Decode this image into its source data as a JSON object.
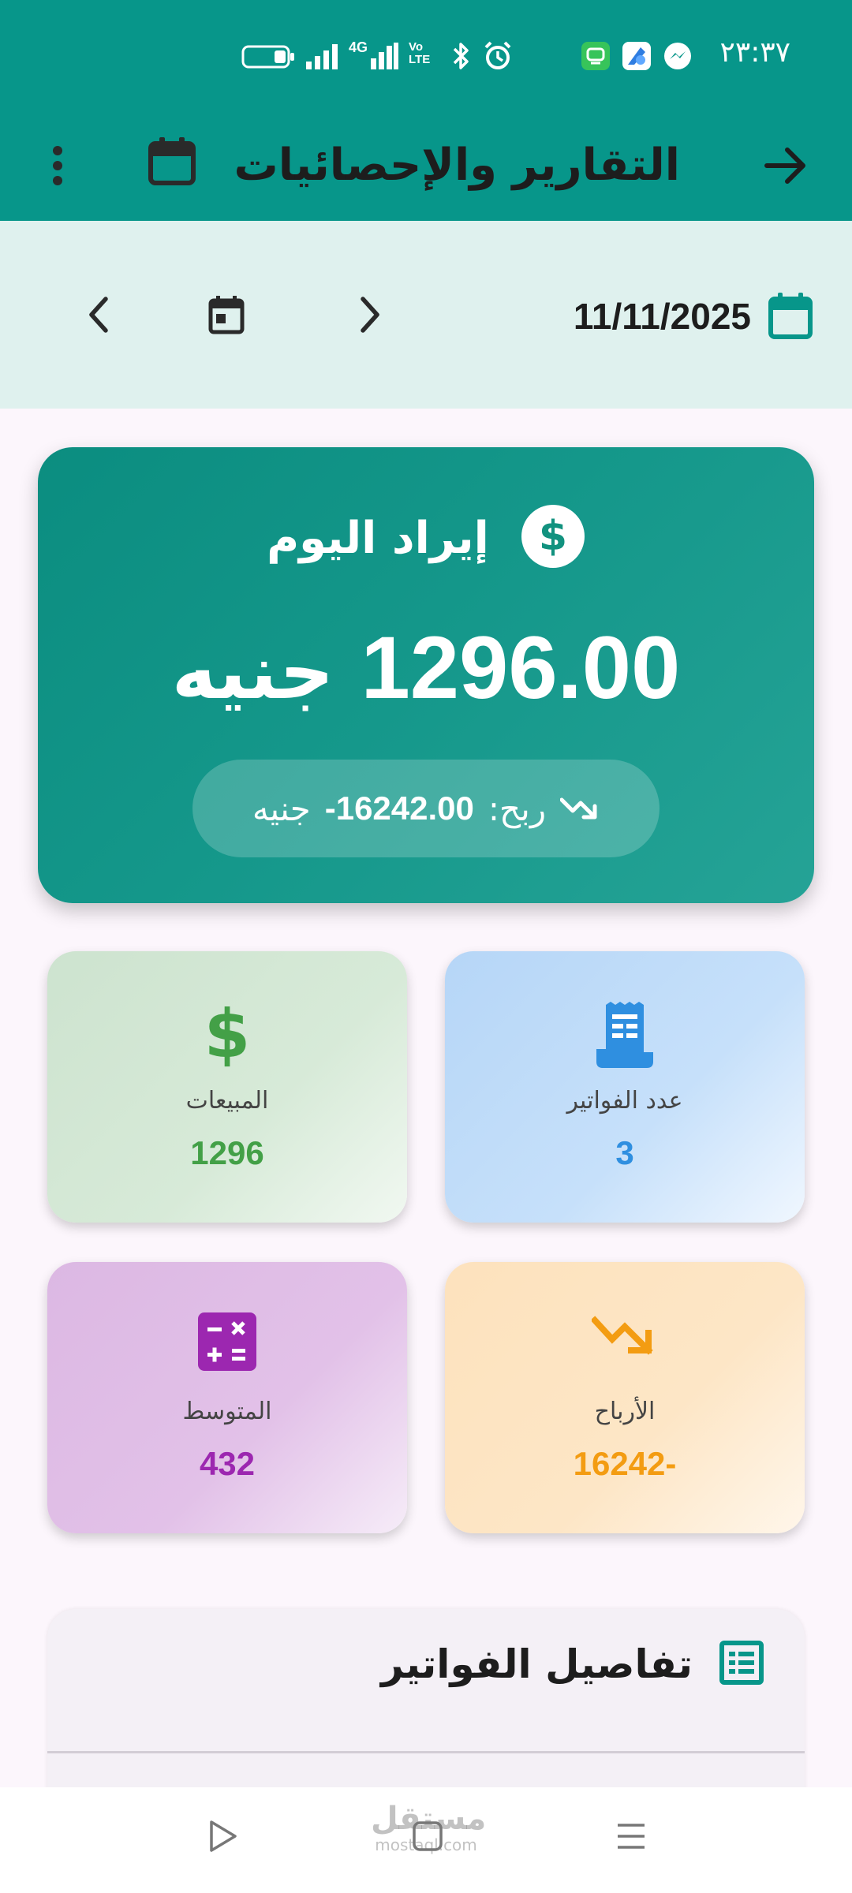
{
  "status_bar": {
    "time": "٢٣:٣٧",
    "battery_icon": "battery-icon",
    "signal_icon": "signal-icon",
    "network_label": "4G",
    "volte_label": "Vo LTE",
    "bluetooth_icon": "bluetooth-icon",
    "alarm_icon": "alarm-icon",
    "notification_icons": [
      "chat-app-icon",
      "photo-app-icon",
      "messenger-icon"
    ]
  },
  "app_bar": {
    "title": "التقارير والإحصائيات",
    "back_icon": "arrow-right-icon",
    "calendar_icon": "calendar-icon",
    "menu_icon": "more-vert-icon",
    "color": "#07968a"
  },
  "date_bar": {
    "date": "11/11/2025",
    "date_icon": "calendar-icon",
    "next_icon": "chevron-right-icon",
    "today_icon": "today-icon",
    "prev_icon": "chevron-left-icon"
  },
  "revenue": {
    "title": "إيراد اليوم",
    "icon": "dollar-circle-icon",
    "amount": "1296.00",
    "currency": "جنيه",
    "profit_label": "ربح:",
    "profit_value": "-16242.00",
    "profit_currency": "جنيه",
    "profit_icon": "trending-down-icon"
  },
  "stats": {
    "invoices": {
      "label": "عدد الفواتير",
      "value": "3",
      "icon": "receipt-icon",
      "color": "#2f8fe0"
    },
    "sales": {
      "label": "المبيعات",
      "value": "1296",
      "icon": "dollar-icon",
      "color": "#43a047"
    },
    "profits": {
      "label": "الأرباح",
      "value": "16242-",
      "icon": "trending-down-icon",
      "color": "#f39c12"
    },
    "average": {
      "label": "المتوسط",
      "value": "432",
      "icon": "calculator-icon",
      "color": "#9c27b0"
    }
  },
  "invoice_details": {
    "title": "تفاصيل الفواتير",
    "icon": "table-icon"
  },
  "nav_bar": {
    "back_icon": "nav-back-icon",
    "home_icon": "nav-home-icon",
    "recents_icon": "nav-menu-icon"
  },
  "watermark": {
    "arabic": "مستقل",
    "latin": "mostaql.com"
  }
}
